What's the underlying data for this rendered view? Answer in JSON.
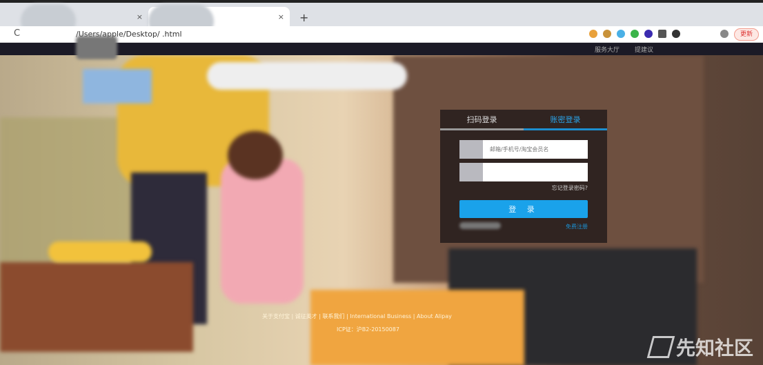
{
  "browser": {
    "tabs": [
      {
        "label": "",
        "close": "×"
      },
      {
        "label": "",
        "close": "×"
      }
    ],
    "new_tab": "+",
    "reload": "C",
    "url": "/Users/apple/Desktop/ .html",
    "update_label": "更新"
  },
  "topnav": {
    "items": [
      "服务大厅",
      "提建议"
    ]
  },
  "login": {
    "tab_qr": "扫码登录",
    "tab_password": "账密登录",
    "username_placeholder": "邮箱/手机号/淘宝会员名",
    "password_placeholder": "",
    "forgot": "忘记登录密码?",
    "submit": "登 录",
    "register": "免费注册"
  },
  "footer": {
    "links": "关于支付宝 | 诚征英才 | 联系我们 | International Business | About Alipay",
    "icp": "ICP证：沪B2-20150087"
  },
  "watermark": "先知社区"
}
